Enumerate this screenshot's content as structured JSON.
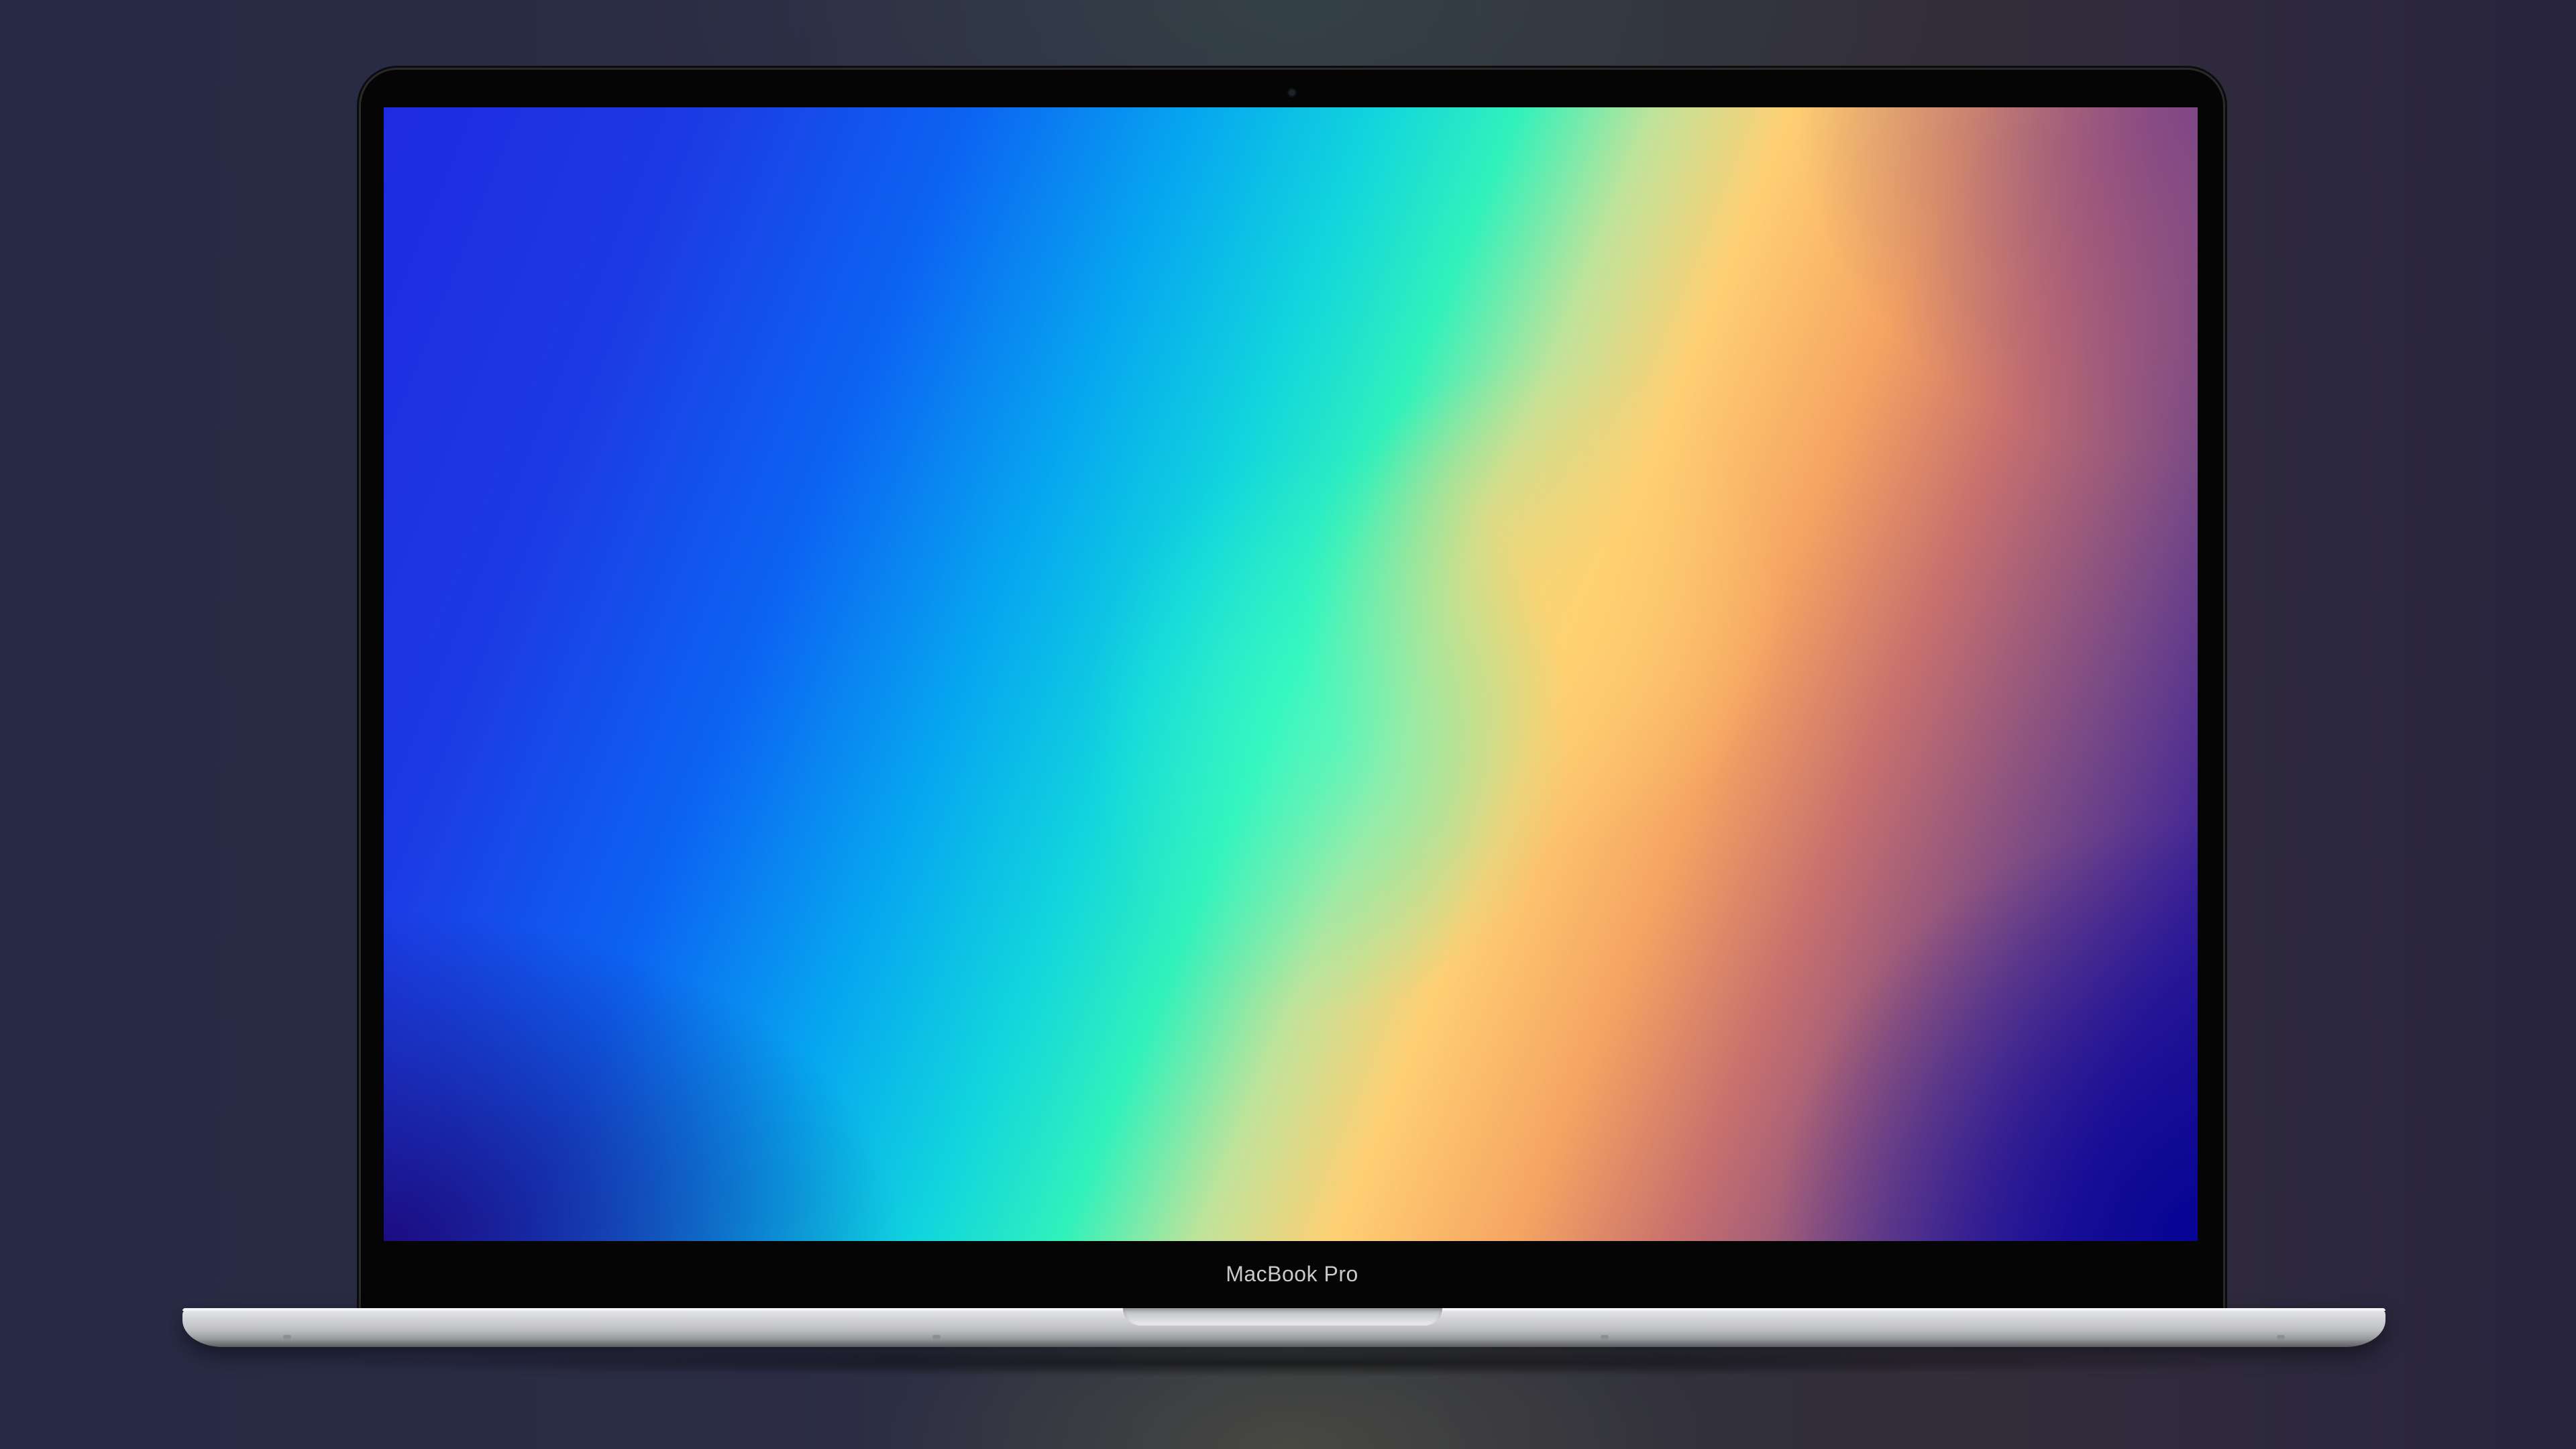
{
  "device": {
    "brand_label": "MacBook Pro"
  },
  "colors": {
    "background": "#2a2c42",
    "bezel": "#050505",
    "aluminum": "#c6c7ca",
    "wallpaper_stops": [
      "#1f2be0",
      "#0c64f2",
      "#12d6dc",
      "#31f1bb",
      "#ffcf73",
      "#f5a462",
      "#7a4a85",
      "#20128c"
    ]
  }
}
